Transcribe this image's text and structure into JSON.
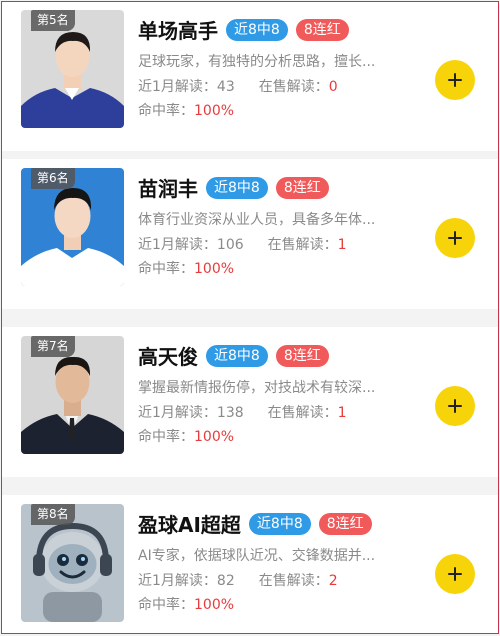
{
  "experts": [
    {
      "rank": "第5名",
      "name": "单场高手",
      "badge_streak": "近8中8",
      "badge_run": "8连红",
      "desc": "足球玩家，有独特的分析思路，擅长...",
      "monthly_label": "近1月解读：",
      "monthly_value": "43",
      "sale_label": "在售解读：",
      "sale_value": "0",
      "rate_label": "命中率：",
      "rate_value": "100%",
      "add_label": "+"
    },
    {
      "rank": "第6名",
      "name": "苗润丰",
      "badge_streak": "近8中8",
      "badge_run": "8连红",
      "desc": "体育行业资深从业人员，具备多年体...",
      "monthly_label": "近1月解读：",
      "monthly_value": "106",
      "sale_label": "在售解读：",
      "sale_value": "1",
      "rate_label": "命中率：",
      "rate_value": "100%",
      "add_label": "+"
    },
    {
      "rank": "第7名",
      "name": "高天俊",
      "badge_streak": "近8中8",
      "badge_run": "8连红",
      "desc": "掌握最新情报伤停，对技战术有较深...",
      "monthly_label": "近1月解读：",
      "monthly_value": "138",
      "sale_label": "在售解读：",
      "sale_value": "1",
      "rate_label": "命中率：",
      "rate_value": "100%",
      "add_label": "+"
    },
    {
      "rank": "第8名",
      "name": "盈球AI超超",
      "badge_streak": "近8中8",
      "badge_run": "8连红",
      "desc": "AI专家，依据球队近况、交锋数据并...",
      "monthly_label": "近1月解读：",
      "monthly_value": "82",
      "sale_label": "在售解读：",
      "sale_value": "2",
      "rate_label": "命中率：",
      "rate_value": "100%",
      "add_label": "+"
    }
  ],
  "colors": {
    "badge_blue": "#2f9ae6",
    "badge_red": "#f15a5a",
    "highlight_red": "#e83b3b",
    "add_button": "#f7d40a"
  }
}
